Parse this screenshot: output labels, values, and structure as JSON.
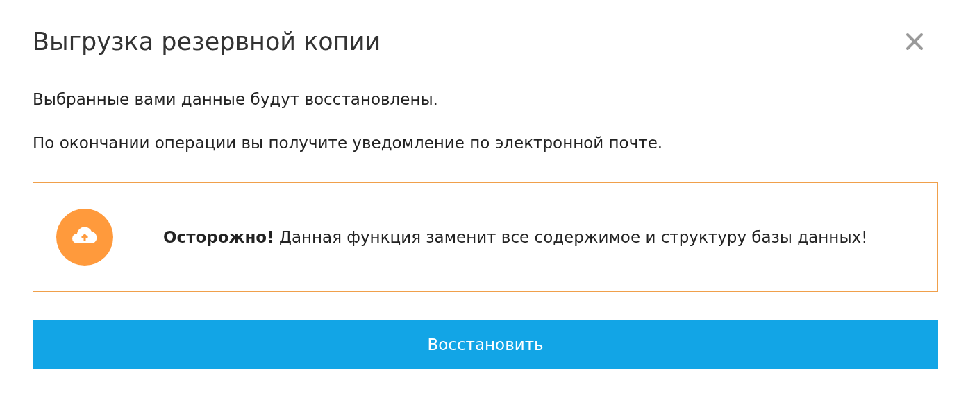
{
  "dialog": {
    "title": "Выгрузка резервной копии",
    "paragraphs": [
      "Выбранные вами данные будут восстановлены.",
      "По окончании операции вы получите уведомление по электронной почте."
    ],
    "warning": {
      "text": "**Осторожно!** Данная функция заменит все содержимое и структуру базы данных!"
    },
    "button": "Восстановить"
  }
}
